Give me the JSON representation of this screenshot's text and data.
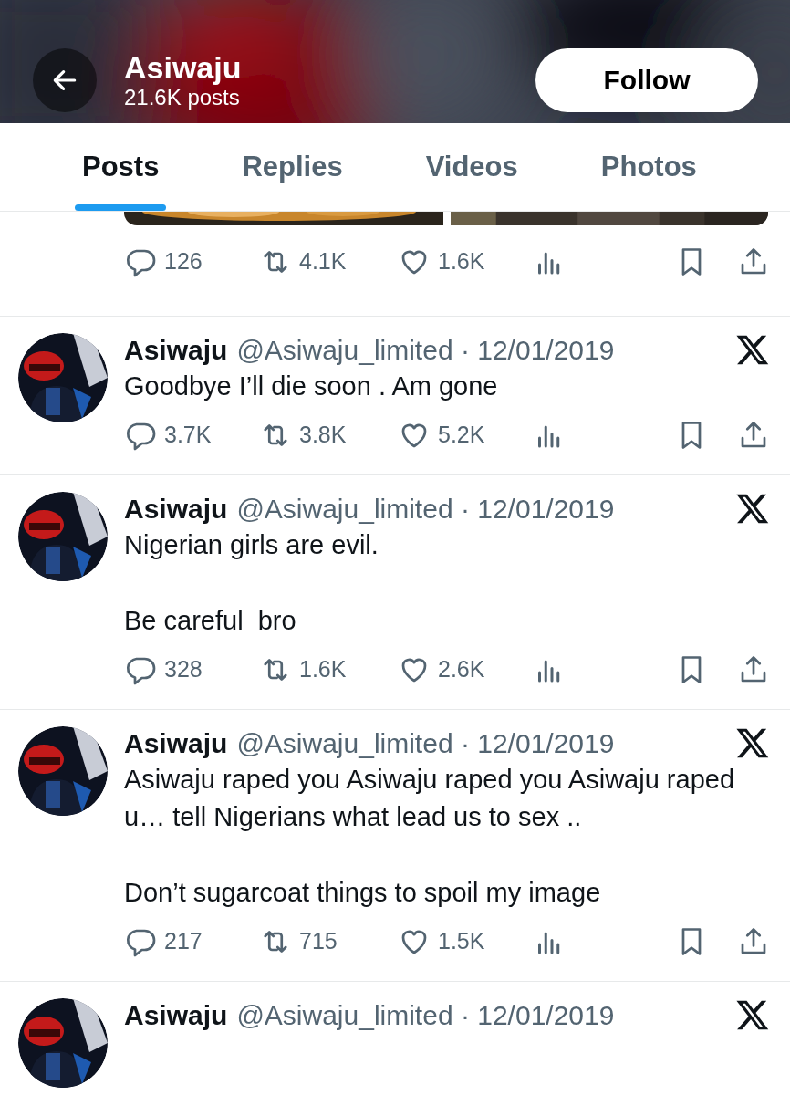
{
  "header": {
    "title": "Asiwaju",
    "subtitle": "21.6K posts",
    "follow_label": "Follow"
  },
  "tabs": [
    {
      "label": "Posts",
      "selected": true
    },
    {
      "label": "Replies",
      "selected": false
    },
    {
      "label": "Videos",
      "selected": false
    },
    {
      "label": "Photos",
      "selected": false
    }
  ],
  "top_post": {
    "replies": "126",
    "reposts": "4.1K",
    "likes": "1.6K"
  },
  "posts": [
    {
      "name": "Asiwaju",
      "meta": "@Asiwaju_limited · 12/01/2019",
      "paragraphs": [
        "Goodbye I’ll die soon . Am gone"
      ],
      "replies": "3.7K",
      "reposts": "3.8K",
      "likes": "5.2K"
    },
    {
      "name": "Asiwaju",
      "meta": "@Asiwaju_limited · 12/01/2019",
      "paragraphs": [
        "Nigerian girls are evil.",
        "Be careful  bro"
      ],
      "replies": "328",
      "reposts": "1.6K",
      "likes": "2.6K"
    },
    {
      "name": "Asiwaju",
      "meta": "@Asiwaju_limited · 12/01/2019",
      "paragraphs": [
        "Asiwaju raped you Asiwaju raped you Asiwaju raped u… tell Nigerians what lead us to sex ..",
        "Don’t sugarcoat things to spoil my image"
      ],
      "replies": "217",
      "reposts": "715",
      "likes": "1.5K"
    },
    {
      "name": "Asiwaju",
      "meta": "@Asiwaju_limited · 12/01/2019"
    }
  ]
}
